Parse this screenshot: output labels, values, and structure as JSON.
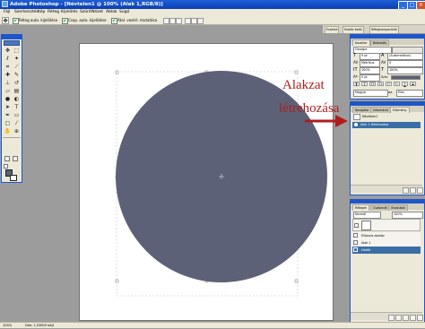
{
  "window": {
    "title": "Adobe Photoshop - [Névtelen1 @ 100% (Alak 1,RGB/8)]"
  },
  "window_controls": {
    "minimize": "_",
    "restore": "□",
    "close": "×"
  },
  "menu": [
    "Fájl",
    "Szerkesztés",
    "Kép",
    "Réteg",
    "Kijelölés",
    "Szűrő",
    "Nézet",
    "Ablak",
    "Súgó"
  ],
  "options_bar": {
    "checkbox1": "Réteg auto. kijelölése",
    "checkbox2": "Csop. auto. kijelölése",
    "checkbox3": "Átal. vezérl. mutatása"
  },
  "palette_well_tabs": [
    "Ecsetek",
    "Eszköz beáll.",
    "Rétegkompozíciók"
  ],
  "character_panel": {
    "tabs": [
      "Karakter",
      "Bekezdés"
    ],
    "font_family": "Georgia",
    "font_size": "9 pt",
    "leading": "(Automatikus)",
    "kerning": "Metrikus",
    "tracking": "0",
    "vscale": "100%",
    "hscale": "100%",
    "baseline": "0 pt",
    "color_label": "Szín:",
    "language": "Magyar",
    "antialias": "Éles",
    "color": "#5d6178"
  },
  "history_panel": {
    "tabs": [
      "Navigátor",
      "Információ",
      "Előzmény"
    ],
    "items": [
      "Névtelen1",
      "Alak 1 létrehozása"
    ]
  },
  "layers_panel": {
    "tabs": [
      "Rétegek",
      "Csatornák",
      "Útvonalak"
    ],
    "blend_mode": "Normál",
    "opacity": "100%",
    "layers": [
      {
        "name": "Ellipszis eszköz",
        "selected": false
      },
      {
        "name": "Alak 1",
        "selected": false
      },
      {
        "name": "Háttér",
        "selected": true
      }
    ]
  },
  "annotation": {
    "line1": "Alakzat",
    "line2": "létrehozása",
    "color": "#b11d1d"
  },
  "canvas": {
    "shape": "ellipse",
    "shape_color": "#5d6178"
  },
  "status_bar": {
    "zoom": "100%",
    "doc_info": "Dok: 1,03M/0 bájt"
  },
  "tools": [
    "move-icon",
    "marquee-icon",
    "lasso-icon",
    "magic-wand-icon",
    "crop-icon",
    "slice-icon",
    "healing-icon",
    "brush-icon",
    "clone-stamp-icon",
    "history-brush-icon",
    "eraser-icon",
    "gradient-icon",
    "blur-icon",
    "dodge-icon",
    "path-select-icon",
    "type-icon",
    "pen-icon",
    "shape-icon",
    "notes-icon",
    "eyedropper-icon",
    "hand-icon",
    "zoom-icon"
  ]
}
